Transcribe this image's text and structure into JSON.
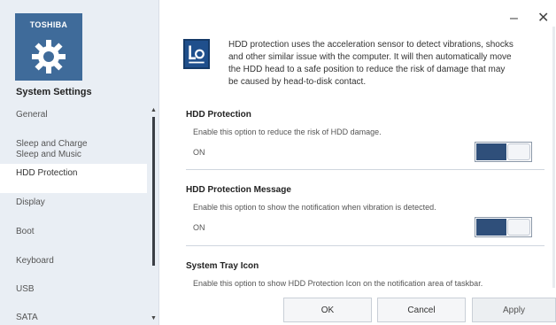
{
  "brand": "TOSHIBA",
  "app_title": "System Settings",
  "nav": {
    "items": [
      {
        "label": "General"
      },
      {
        "label": "Sleep and Charge"
      },
      {
        "label": "Sleep and Music"
      },
      {
        "label": "HDD Protection",
        "active": true
      },
      {
        "label": "Display"
      },
      {
        "label": "Boot"
      },
      {
        "label": "Keyboard"
      },
      {
        "label": "USB"
      },
      {
        "label": "SATA"
      }
    ]
  },
  "window_controls": {
    "minimize": "–",
    "close": "✕"
  },
  "info": {
    "text": "HDD protection uses the acceleration sensor to detect vibrations, shocks and other similar issue with the computer. It will then automatically move the HDD head to a safe position to reduce the risk of damage that may be caused by head-to-disk contact."
  },
  "sections": [
    {
      "title": "HDD Protection",
      "desc": "Enable this option to reduce the risk of HDD damage.",
      "state": "ON"
    },
    {
      "title": "HDD Protection Message",
      "desc": "Enable this option to show the notification when vibration is detected.",
      "state": "ON"
    },
    {
      "title": "System Tray Icon",
      "desc": "Enable this option to show HDD Protection Icon on the notification area of taskbar."
    }
  ],
  "buttons": {
    "ok": "OK",
    "cancel": "Cancel",
    "apply": "Apply"
  },
  "colors": {
    "accent": "#2f4f7a",
    "logo_tile": "#3f6b9a",
    "sidebar_bg": "#e9eef4"
  },
  "icons": {
    "logo": "gear-icon",
    "info": "hdd-protection-icon"
  }
}
